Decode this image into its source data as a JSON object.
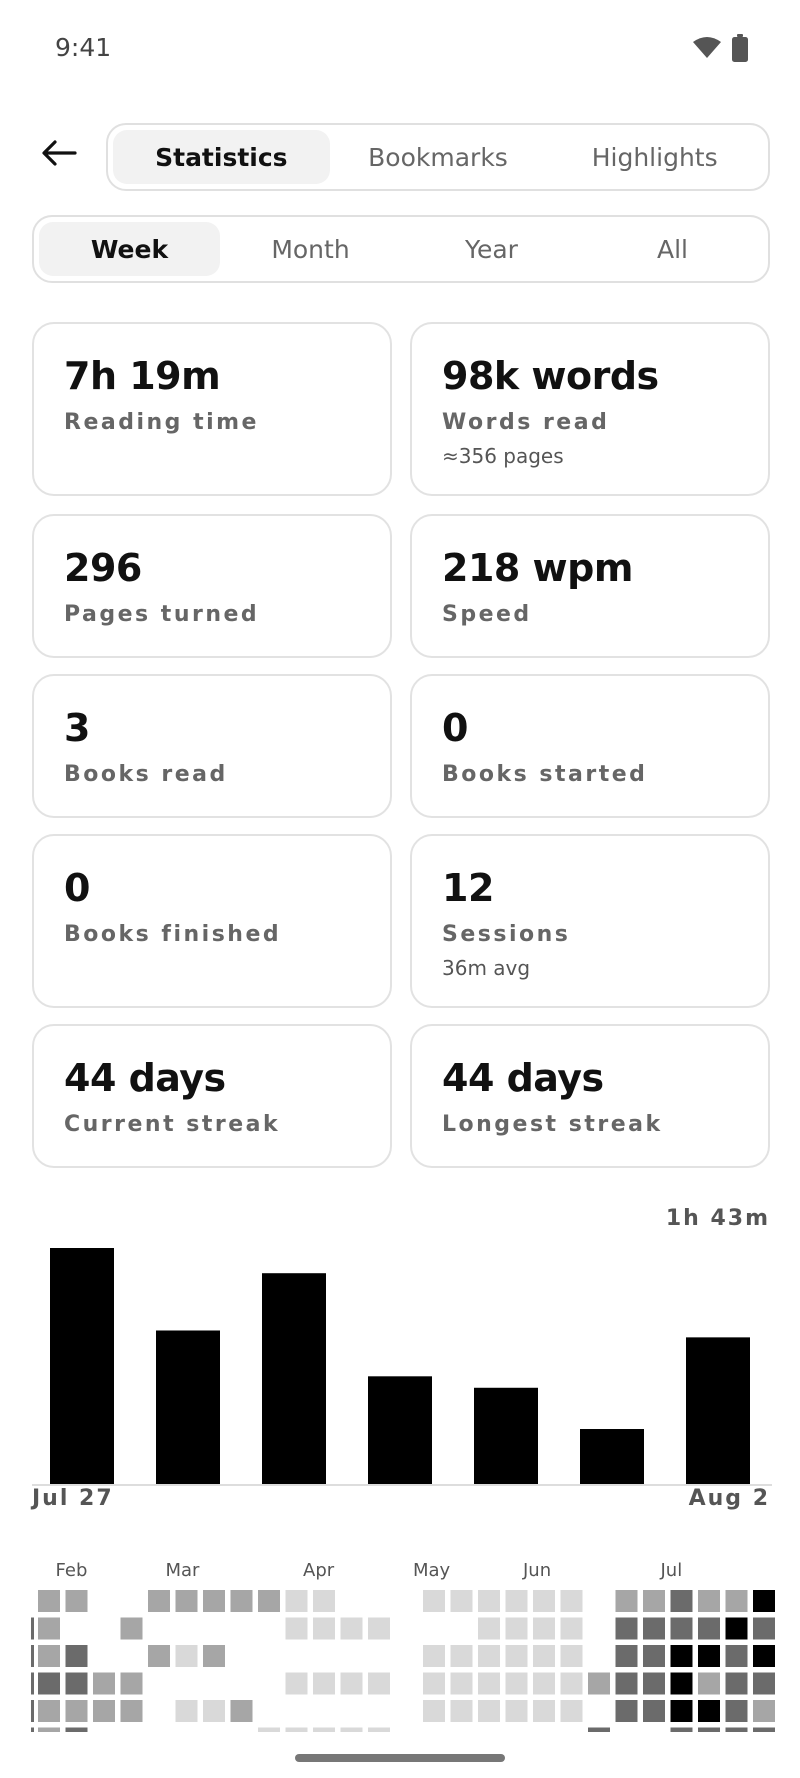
{
  "status_bar": {
    "time": "9:41"
  },
  "tabs": [
    {
      "label": "Statistics",
      "active": true
    },
    {
      "label": "Bookmarks",
      "active": false
    },
    {
      "label": "Highlights",
      "active": false
    }
  ],
  "periods": [
    {
      "label": "Week",
      "active": true
    },
    {
      "label": "Month",
      "active": false
    },
    {
      "label": "Year",
      "active": false
    },
    {
      "label": "All",
      "active": false
    }
  ],
  "stats": [
    {
      "value": "7h 19m",
      "label": "Reading time",
      "sub": ""
    },
    {
      "value": "98k words",
      "label": "Words read",
      "sub": "≈356 pages"
    },
    {
      "value": "296",
      "label": "Pages turned",
      "sub": ""
    },
    {
      "value": "218 wpm",
      "label": "Speed",
      "sub": ""
    },
    {
      "value": "3",
      "label": "Books read",
      "sub": ""
    },
    {
      "value": "0",
      "label": "Books started",
      "sub": ""
    },
    {
      "value": "0",
      "label": "Books finished",
      "sub": ""
    },
    {
      "value": "12",
      "label": "Sessions",
      "sub": "36m avg"
    },
    {
      "value": "44 days",
      "label": "Current streak",
      "sub": ""
    },
    {
      "value": "44 days",
      "label": "Longest streak",
      "sub": ""
    }
  ],
  "chart_data": {
    "type": "bar",
    "max_label": "1h 43m",
    "x_start_label": "Jul 27",
    "x_end_label": "Aug 2",
    "values_minutes": [
      103,
      67,
      92,
      47,
      42,
      24,
      64
    ],
    "bar_color": "#000000"
  },
  "heatmap": {
    "months": [
      "Feb",
      "Mar",
      "Apr",
      "May",
      "Jun",
      "Jul"
    ],
    "palette": [
      "#ffffff",
      "#d9d9d9",
      "#a6a6a6",
      "#6b6b6b",
      "#000000"
    ],
    "columns": [
      [
        2,
        2,
        2,
        3,
        2,
        2
      ],
      [
        2,
        0,
        3,
        3,
        2,
        3
      ],
      [
        0,
        0,
        0,
        2,
        2,
        0
      ],
      [
        0,
        2,
        0,
        2,
        2,
        0
      ],
      [
        2,
        0,
        2,
        0,
        0,
        0
      ],
      [
        2,
        0,
        1,
        0,
        1,
        0
      ],
      [
        2,
        0,
        2,
        0,
        1,
        0
      ],
      [
        2,
        0,
        0,
        0,
        2,
        0
      ],
      [
        2,
        0,
        0,
        0,
        0,
        1
      ],
      [
        1,
        1,
        0,
        1,
        0,
        1
      ],
      [
        1,
        1,
        0,
        1,
        0,
        1
      ],
      [
        0,
        1,
        0,
        1,
        0,
        1
      ],
      [
        0,
        1,
        0,
        1,
        0,
        1
      ],
      [
        0,
        0,
        0,
        0,
        0,
        0
      ],
      [
        1,
        0,
        1,
        1,
        1,
        0
      ],
      [
        1,
        0,
        1,
        1,
        1,
        0
      ],
      [
        1,
        1,
        1,
        1,
        1,
        0
      ],
      [
        1,
        1,
        1,
        1,
        1,
        0
      ],
      [
        1,
        1,
        1,
        1,
        1,
        0
      ],
      [
        1,
        1,
        1,
        1,
        1,
        0
      ],
      [
        0,
        0,
        0,
        2,
        0,
        3
      ],
      [
        2,
        3,
        3,
        3,
        3,
        0
      ],
      [
        2,
        3,
        3,
        3,
        3,
        0
      ],
      [
        3,
        3,
        4,
        4,
        4,
        3
      ],
      [
        2,
        3,
        4,
        2,
        4,
        3
      ],
      [
        2,
        4,
        3,
        3,
        3,
        3
      ],
      [
        4,
        3,
        4,
        3,
        2,
        3
      ]
    ]
  }
}
